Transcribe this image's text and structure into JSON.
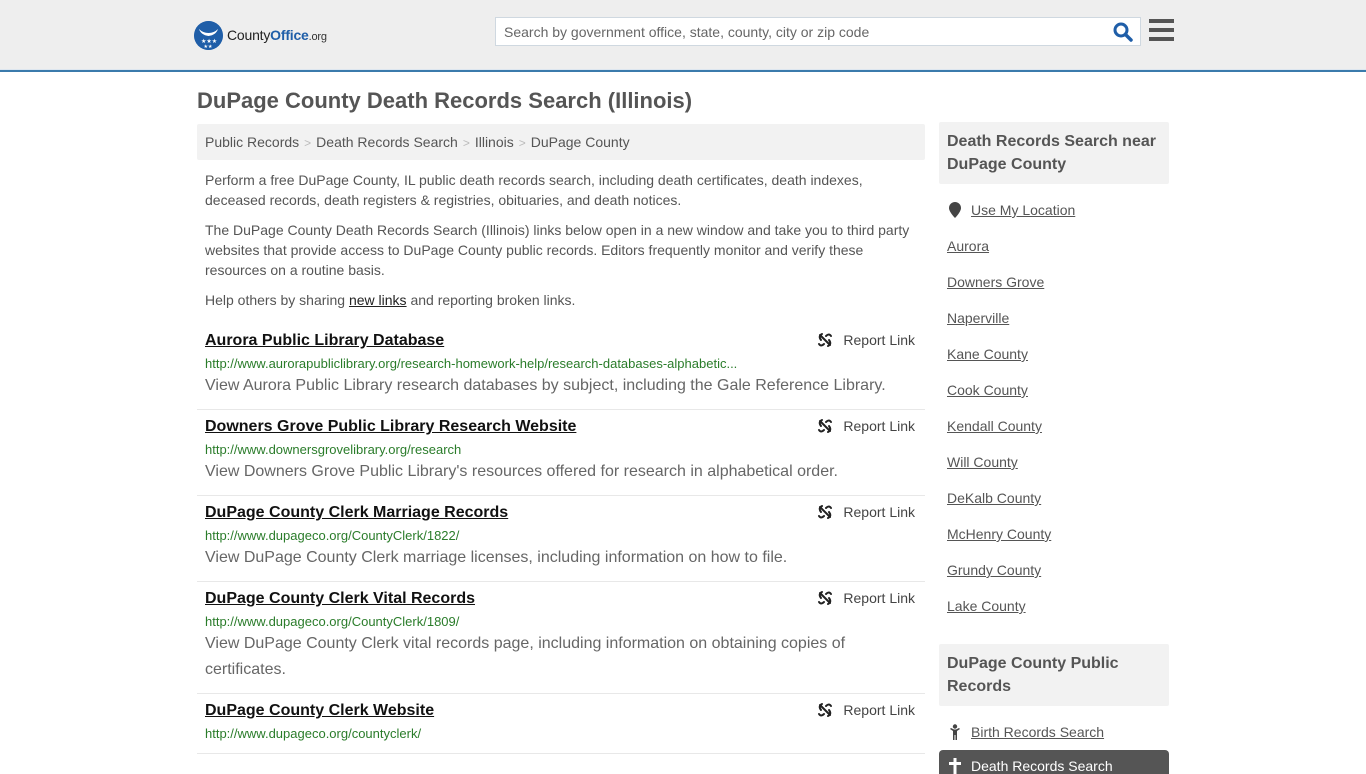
{
  "header": {
    "logo": {
      "name": "County",
      "brand": "Office",
      "tld": ".org"
    },
    "search": {
      "placeholder": "Search by government office, state, county, city or zip code",
      "value": ""
    },
    "colors": {
      "accent": "#1f5ea8",
      "border": "#3b7bac"
    }
  },
  "page": {
    "title": "DuPage County Death Records Search (Illinois)"
  },
  "breadcrumb": [
    {
      "label": "Public Records"
    },
    {
      "label": "Death Records Search"
    },
    {
      "label": "Illinois"
    },
    {
      "label": "DuPage County"
    }
  ],
  "intro": {
    "p1": "Perform a free DuPage County, IL public death records search, including death certificates, death indexes, deceased records, death registers & registries, obituaries, and death notices.",
    "p2": "The DuPage County Death Records Search (Illinois) links below open in a new window and take you to third party websites that provide access to DuPage County public records. Editors frequently monitor and verify these resources on a routine basis.",
    "p3_before": "Help others by sharing ",
    "p3_link": "new links",
    "p3_after": " and reporting broken links."
  },
  "results": [
    {
      "title": "Aurora Public Library Database",
      "url": "http://www.aurorapubliclibrary.org/research-homework-help/research-databases-alphabetic...",
      "desc": "View Aurora Public Library research databases by subject, including the Gale Reference Library.",
      "report": "Report Link"
    },
    {
      "title": "Downers Grove Public Library Research Website",
      "url": "http://www.downersgrovelibrary.org/research",
      "desc": "View Downers Grove Public Library's resources offered for research in alphabetical order.",
      "report": "Report Link"
    },
    {
      "title": "DuPage County Clerk Marriage Records",
      "url": "http://www.dupageco.org/CountyClerk/1822/",
      "desc": "View DuPage County Clerk marriage licenses, including information on how to file.",
      "report": "Report Link"
    },
    {
      "title": "DuPage County Clerk Vital Records",
      "url": "http://www.dupageco.org/CountyClerk/1809/",
      "desc": "View DuPage County Clerk vital records page, including information on obtaining copies of certificates.",
      "report": "Report Link"
    },
    {
      "title": "DuPage County Clerk Website",
      "url": "http://www.dupageco.org/countyclerk/",
      "desc": "",
      "report": "Report Link"
    }
  ],
  "sidebar": {
    "nearby_heading": "Death Records Search near DuPage County",
    "use_location": "Use My Location",
    "nearby": [
      "Aurora",
      "Downers Grove",
      "Naperville",
      "Kane County",
      "Cook County",
      "Kendall County",
      "Will County",
      "DeKalb County",
      "McHenry County",
      "Grundy County",
      "Lake County"
    ],
    "records_heading": "DuPage County Public Records",
    "records": [
      {
        "label": "Birth Records Search",
        "icon": "child-icon",
        "active": false
      },
      {
        "label": "Death Records Search",
        "icon": "cross-icon",
        "active": true
      }
    ]
  }
}
